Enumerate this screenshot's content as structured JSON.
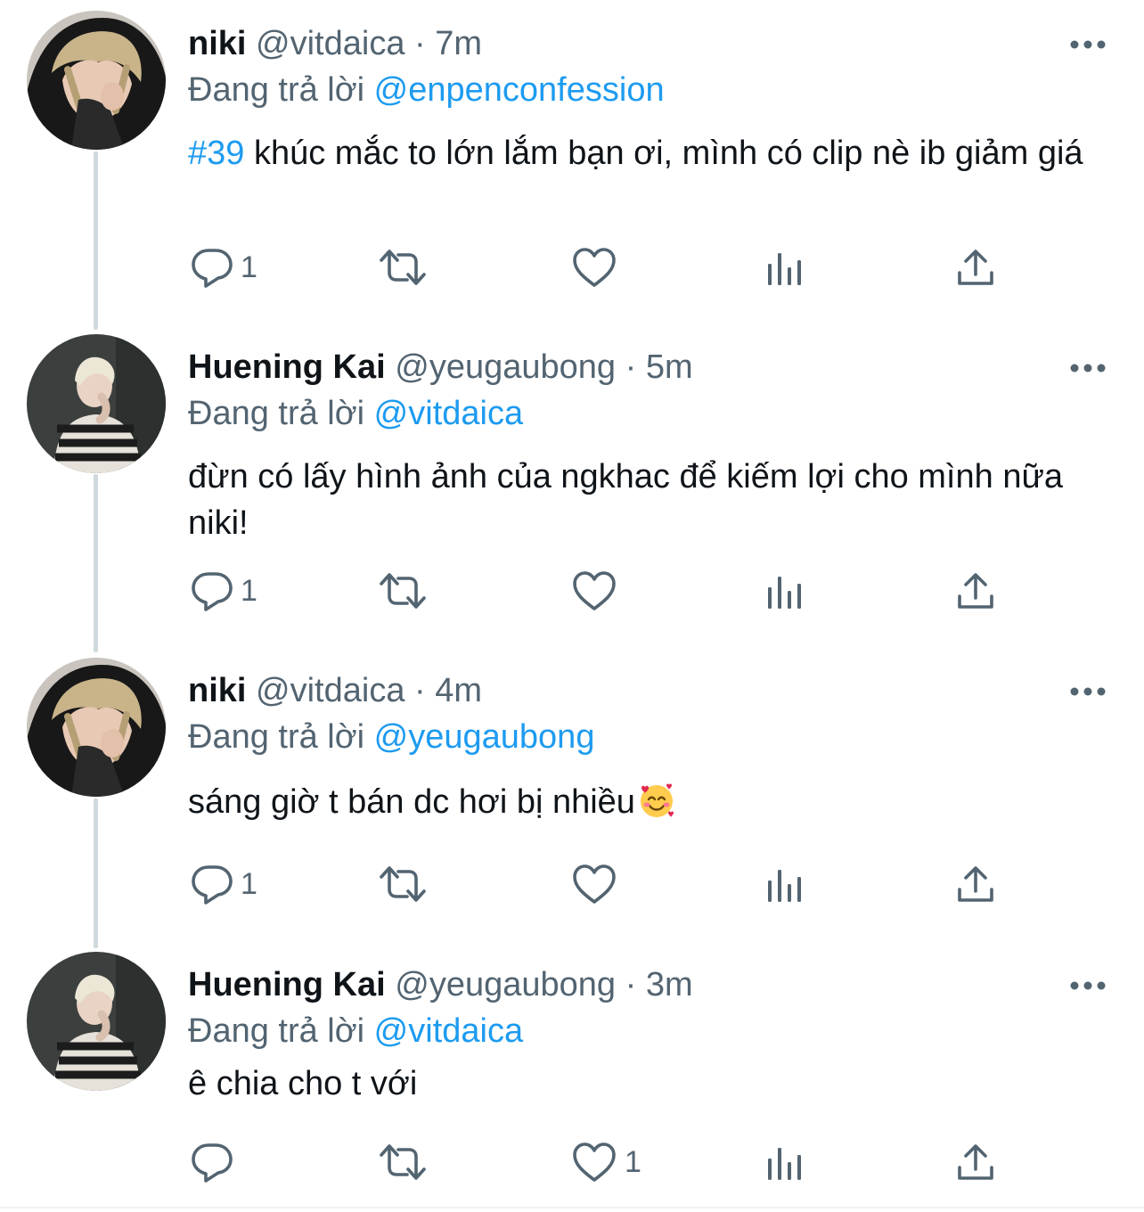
{
  "colors": {
    "accent": "#1d9bf0",
    "secondary_text": "#536471",
    "primary_text": "#0f1419",
    "thread_line": "#cfd9de"
  },
  "replying_prefix": "Đang trả lời",
  "tweets": [
    {
      "display_name": "niki",
      "handle": "@vitdaica",
      "dot": "·",
      "time": "7m",
      "replying_to": "@enpenconfession",
      "hashtag": "#39",
      "text": " khúc mắc to lớn lắm bạn ơi, mình có clip nè ib giảm giá",
      "reply_count": "1",
      "retweet_count": "",
      "like_count": "",
      "avatar_icon": "profile-photo-dark-hood"
    },
    {
      "display_name": "Huening Kai",
      "handle": "@yeugaubong",
      "dot": "·",
      "time": "5m",
      "replying_to": "@vitdaica",
      "hashtag": "",
      "text": "đừn có lấy hình ảnh của ngkhac để kiếm lợi cho mình nữa niki!",
      "reply_count": "1",
      "retweet_count": "",
      "like_count": "",
      "avatar_icon": "profile-photo-striped-sweater"
    },
    {
      "display_name": "niki",
      "handle": "@vitdaica",
      "dot": "·",
      "time": "4m",
      "replying_to": "@yeugaubong",
      "hashtag": "",
      "text": "sáng giờ t bán dc hơi bị nhiều",
      "emoji": "smiling-face-with-hearts-icon",
      "reply_count": "1",
      "retweet_count": "",
      "like_count": "",
      "avatar_icon": "profile-photo-dark-hood"
    },
    {
      "display_name": "Huening Kai",
      "handle": "@yeugaubong",
      "dot": "·",
      "time": "3m",
      "replying_to": "@vitdaica",
      "hashtag": "",
      "text": "ê chia cho t với",
      "reply_count": "",
      "retweet_count": "",
      "like_count": "1",
      "avatar_icon": "profile-photo-striped-sweater"
    }
  ],
  "action_icons": [
    "reply-icon",
    "retweet-icon",
    "like-icon",
    "analytics-icon",
    "share-icon"
  ],
  "more_icon": "more-options-icon"
}
